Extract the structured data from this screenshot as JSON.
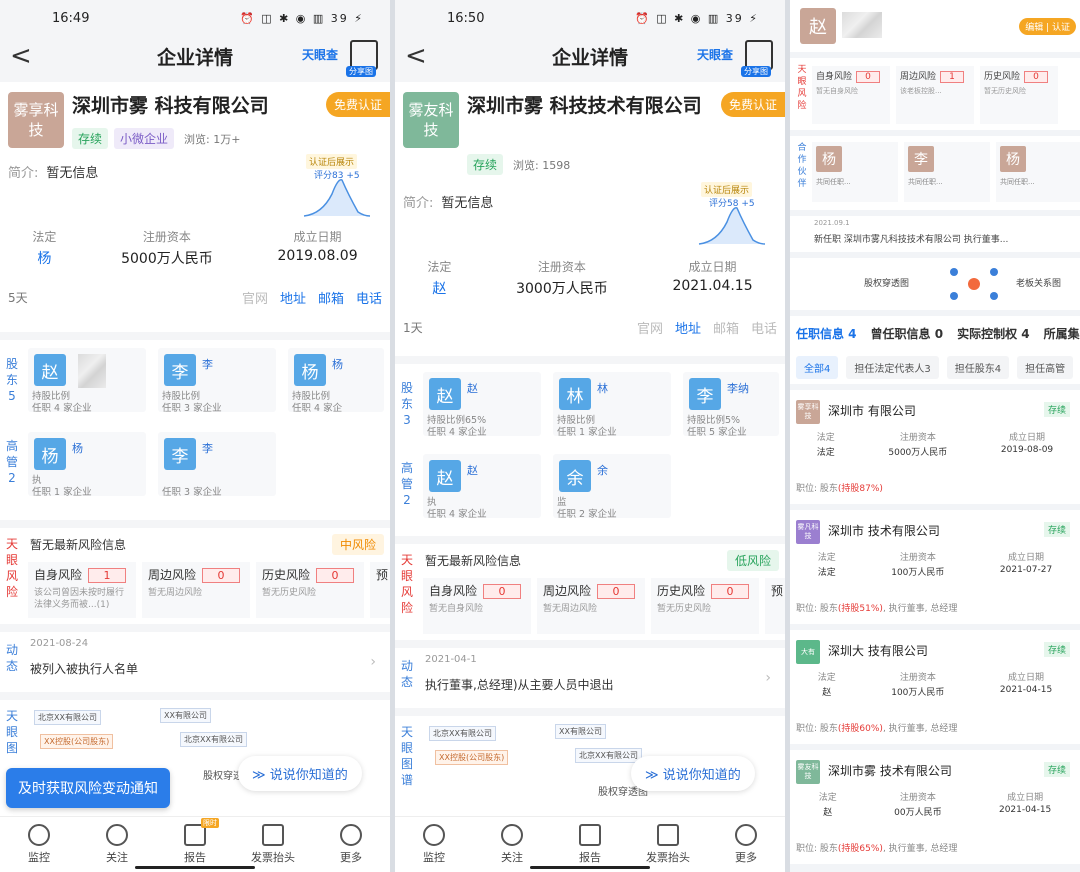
{
  "phone1": {
    "status": {
      "time": "16:49",
      "icons": "⏰ ◫ ✱ ◉ ▥ 39 ⚡"
    },
    "nav": {
      "back": "<",
      "title": "企业详情",
      "tyc": "天眼查",
      "share_badge": "分享图"
    },
    "company": {
      "logo": "雾享科技",
      "name": "深圳市雾  科技有限公司",
      "certify": "免费认证",
      "tags": [
        "存续",
        "小微企业"
      ],
      "views": "浏览: 1万+",
      "intro_label": "简介:",
      "intro": "暂无信息",
      "score_label": "认证后展示",
      "score": "评分83 +5"
    },
    "stats": [
      {
        "k": "法定",
        "v": "杨"
      },
      {
        "k": "注册资本",
        "v": "5000万人民币"
      },
      {
        "k": "成立日期",
        "v": "2019.08.09"
      }
    ],
    "actions": {
      "left": "5天",
      "items": [
        "官网",
        "地址",
        "邮箱",
        "电话"
      ]
    },
    "shareholders_label": "股东5",
    "executives_label": "高管2",
    "shareholders": [
      {
        "av": "赵",
        "l1": "持股比例",
        "l2": "任职 4 家企业"
      },
      {
        "av": "李",
        "nm": "李",
        "l1": "持股比例",
        "l2": "任职 3 家企业"
      },
      {
        "av": "杨",
        "nm": "杨",
        "l1": "持股比例",
        "l2": "任职 4 家企"
      }
    ],
    "executives": [
      {
        "av": "杨",
        "nm": "杨",
        "l1": "执",
        "l2": "任职 1 家企业"
      },
      {
        "av": "李",
        "nm": "李",
        "l1": "",
        "l2": "任职 3 家企业"
      }
    ],
    "risk": {
      "label": "天眼风险",
      "hd": "暂无最新风险信息",
      "level": "中风险",
      "items": [
        {
          "t": "自身风险",
          "n": "1",
          "d": "该公司曾因未按时履行法律义务而被...(1)"
        },
        {
          "t": "周边风险",
          "n": "0",
          "d": "暂无周边风险"
        },
        {
          "t": "历史风险",
          "n": "0",
          "d": "暂无历史风险"
        }
      ],
      "more": "预"
    },
    "dyn": {
      "label": "动态",
      "date": "2021-08-24",
      "text": "被列入被执行人名单"
    },
    "graph": {
      "label": "天眼图",
      "n1": "北京XX有限公司",
      "n2": "XX有限公司",
      "n3": "XX控股(公司股东)",
      "n4": "北京XX有限公司",
      "n5": "股权穿透图"
    },
    "toast": "及时获取风险变动通知",
    "bubble": "说说你知道的",
    "tabs": [
      {
        "label": "监控"
      },
      {
        "label": "关注"
      },
      {
        "label": "报告",
        "badge": "限时"
      },
      {
        "label": "发票抬头"
      },
      {
        "label": "更多"
      }
    ]
  },
  "phone2": {
    "status": {
      "time": "16:50",
      "icons": "⏰ ◫ ✱ ◉ ▥ 39 ⚡"
    },
    "nav": {
      "back": "<",
      "title": "企业详情",
      "tyc": "天眼查",
      "share_badge": "分享图"
    },
    "company": {
      "logo": "雾友科技",
      "name": "深圳市雾  科技技术有限公司",
      "certify": "免费认证",
      "tags": [
        "存续"
      ],
      "views": "浏览: 1598",
      "intro_label": "简介:",
      "intro": "暂无信息",
      "score_label": "认证后展示",
      "score": "评分58 +5"
    },
    "stats": [
      {
        "k": "法定",
        "v": "赵"
      },
      {
        "k": "注册资本",
        "v": "3000万人民币"
      },
      {
        "k": "成立日期",
        "v": "2021.04.15"
      }
    ],
    "actions": {
      "left": "1天",
      "items": [
        "官网",
        "地址",
        "邮箱",
        "电话"
      ]
    },
    "shareholders_label": "股东3",
    "executives_label": "高管2",
    "shareholders": [
      {
        "av": "赵",
        "nm": "赵",
        "l1": "持股比例65%",
        "l2": "任职 4 家企业"
      },
      {
        "av": "林",
        "nm": "林",
        "l1": "持股比例",
        "l2": "任职 1 家企业"
      },
      {
        "av": "李",
        "nm": "李纳",
        "l1": "持股比例5%",
        "l2": "任职 5 家企业"
      }
    ],
    "executives": [
      {
        "av": "赵",
        "nm": "赵",
        "l1": "执",
        "l2": "任职 4 家企业"
      },
      {
        "av": "余",
        "nm": "余",
        "l1": "监",
        "l2": "任职 2 家企业"
      }
    ],
    "risk": {
      "label": "天眼风险",
      "hd": "暂无最新风险信息",
      "level": "低风险",
      "items": [
        {
          "t": "自身风险",
          "n": "0",
          "d": "暂无自身风险"
        },
        {
          "t": "周边风险",
          "n": "0",
          "d": "暂无周边风险"
        },
        {
          "t": "历史风险",
          "n": "0",
          "d": "暂无历史风险"
        }
      ],
      "more": "预"
    },
    "dyn": {
      "label": "动态",
      "date": "2021-04-1",
      "text": "执行董事,总经理)从主要人员中退出"
    },
    "graph": {
      "label": "天眼图谱",
      "n1": "北京XX有限公司",
      "n2": "XX有限公司",
      "n3": "XX控股(公司股东)",
      "n4": "北京XX有限公司",
      "n5": "股权穿透图"
    },
    "bubble": "说说你知道的",
    "tabs": [
      {
        "label": "监控"
      },
      {
        "label": "关注"
      },
      {
        "label": "报告"
      },
      {
        "label": "发票抬头"
      },
      {
        "label": "更多"
      }
    ]
  },
  "phone3": {
    "avatar": "赵",
    "btns": "编辑 | 认证",
    "risk_label": "天眼风险",
    "risks": [
      {
        "t": "自身风险",
        "n": "0",
        "d": "暂无自身风险"
      },
      {
        "t": "周边风险",
        "n": "1",
        "d": "该老板控股..."
      },
      {
        "t": "历史风险",
        "n": "0",
        "d": "暂无历史风险"
      }
    ],
    "partner_label": "合作伙伴",
    "partners": [
      {
        "a": "杨",
        "t": "共同任职..."
      },
      {
        "a": "李",
        "t": "共同任职..."
      },
      {
        "a": "杨",
        "t": "共同任职..."
      }
    ],
    "news_date": "2021.09.1",
    "news": "新任职 深圳市雾凡科技技术有限公司 执行董事...",
    "map1": "股权穿透图",
    "map2": "老板关系图",
    "tabs": [
      "任职信息 4",
      "曾任职信息 0",
      "实际控制权 4",
      "所属集团"
    ],
    "chips": [
      "全部4",
      "担任法定代表人3",
      "担任股东4",
      "担任高管"
    ],
    "cards": [
      {
        "lg": "雾享科技",
        "color": "#c9a697",
        "nm": "深圳市        有限公司",
        "st": "存续",
        "c1": "法定",
        "c2": "5000万人民币",
        "c3": "2019-08-09",
        "role": "职位: 股东",
        "pct": "(持股87%)",
        "rest": ""
      },
      {
        "lg": "雾凡科技",
        "color": "#9b7fd0",
        "nm": "深圳市        技术有限公司",
        "st": "存续",
        "c1": "法定",
        "c2": "100万人民币",
        "c3": "2021-07-27",
        "role": "职位: 股东",
        "pct": "(持股51%)",
        "rest": ", 执行董事, 总经理"
      },
      {
        "lg": "大有",
        "color": "#5cb88a",
        "nm": "深圳大        技有限公司",
        "st": "存续",
        "c1": "赵",
        "c2": "100万人民币",
        "c3": "2021-04-15",
        "role": "职位: 股东",
        "pct": "(持股60%)",
        "rest": ", 执行董事, 总经理"
      },
      {
        "lg": "雾友科技",
        "color": "#7fb89a",
        "nm": "深圳市雾        技术有限公司",
        "st": "存续",
        "c1": "赵",
        "c2": "00万人民币",
        "c3": "2021-04-15",
        "role": "职位: 股东",
        "pct": "(持股65%)",
        "rest": ", 执行董事, 总经理"
      }
    ],
    "col_labels": [
      "法定",
      "注册资本",
      "成立日期"
    ]
  }
}
